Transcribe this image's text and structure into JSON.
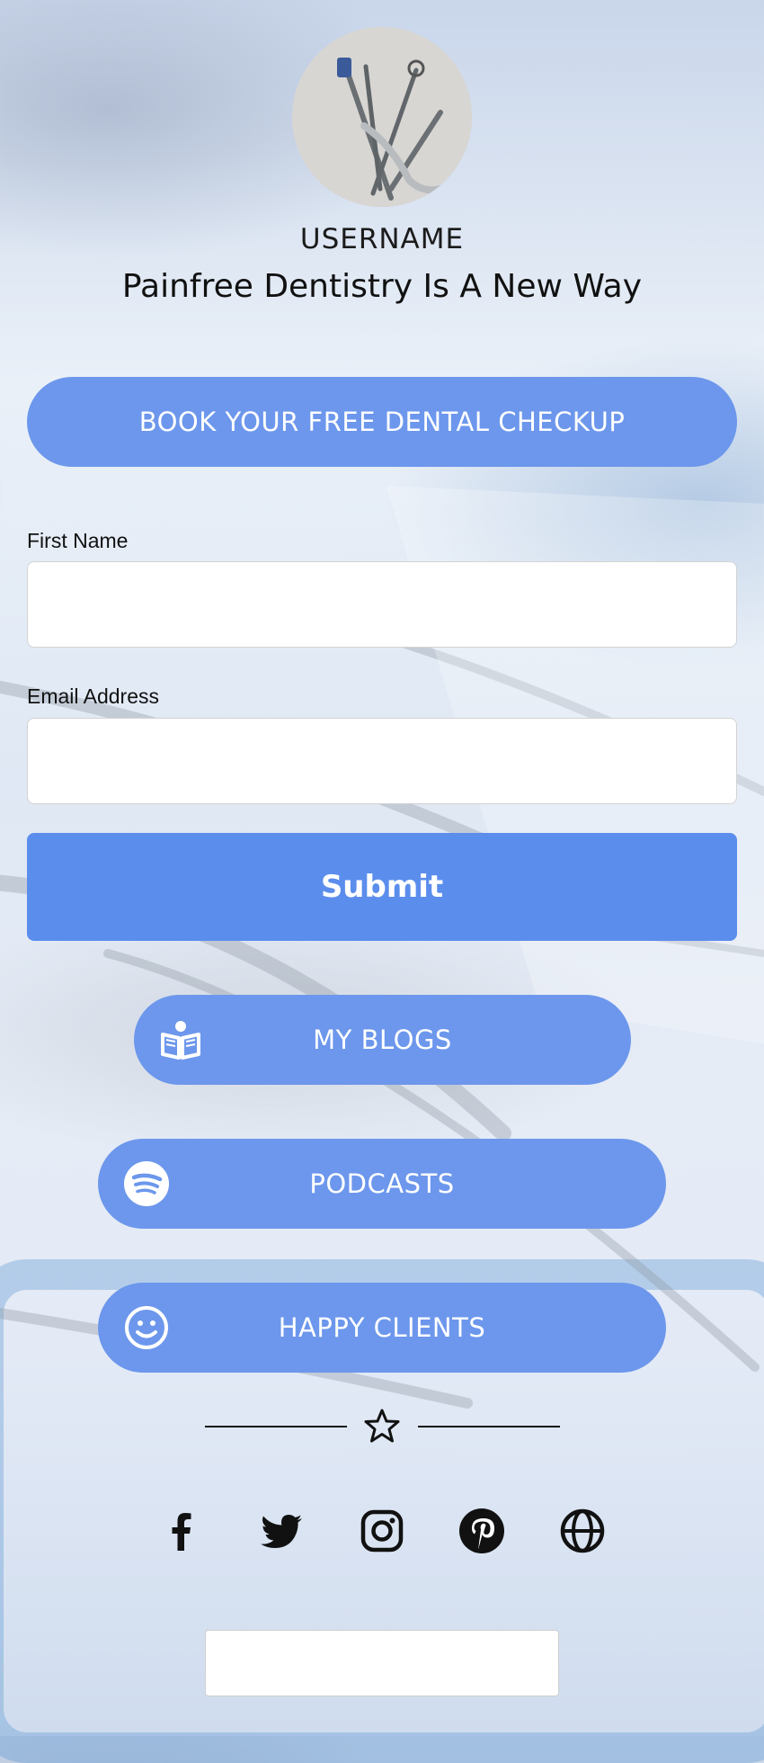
{
  "profile": {
    "username": "USERNAME",
    "tagline": "Painfree Dentistry Is A New Way"
  },
  "cta": {
    "label": "BOOK YOUR FREE DENTAL CHECKUP"
  },
  "form": {
    "first_name_label": "First Name",
    "first_name_value": "",
    "email_label": "Email Address",
    "email_value": "",
    "submit_label": "Submit"
  },
  "links": [
    {
      "label": "MY BLOGS",
      "icon": "book-reader-icon"
    },
    {
      "label": "PODCASTS",
      "icon": "spotify-icon"
    },
    {
      "label": "HAPPY CLIENTS",
      "icon": "smiley-icon"
    }
  ],
  "divider": {
    "icon": "star-icon"
  },
  "social": [
    "facebook-icon",
    "twitter-icon",
    "instagram-icon",
    "pinterest-icon",
    "globe-icon"
  ],
  "colors": {
    "accent": "#6c97ec",
    "submit": "#5b8dec",
    "text": "#111111"
  }
}
